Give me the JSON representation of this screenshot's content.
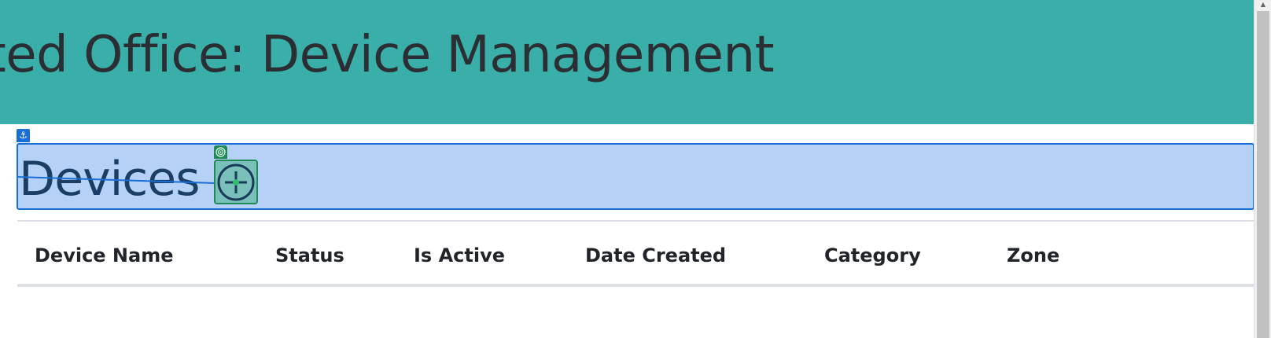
{
  "header": {
    "title": "cted Office: Device Management",
    "background": "#3aafa9"
  },
  "section": {
    "title": "Devices",
    "highlight_color": "#1a6fd6",
    "anchor_icon": "anchor-icon",
    "target_tag_icon": "target-icon",
    "target_icon": "crosshair-icon"
  },
  "table": {
    "columns": [
      "Device Name",
      "Status",
      "Is Active",
      "Date Created",
      "Category",
      "Zone"
    ],
    "rows": []
  }
}
